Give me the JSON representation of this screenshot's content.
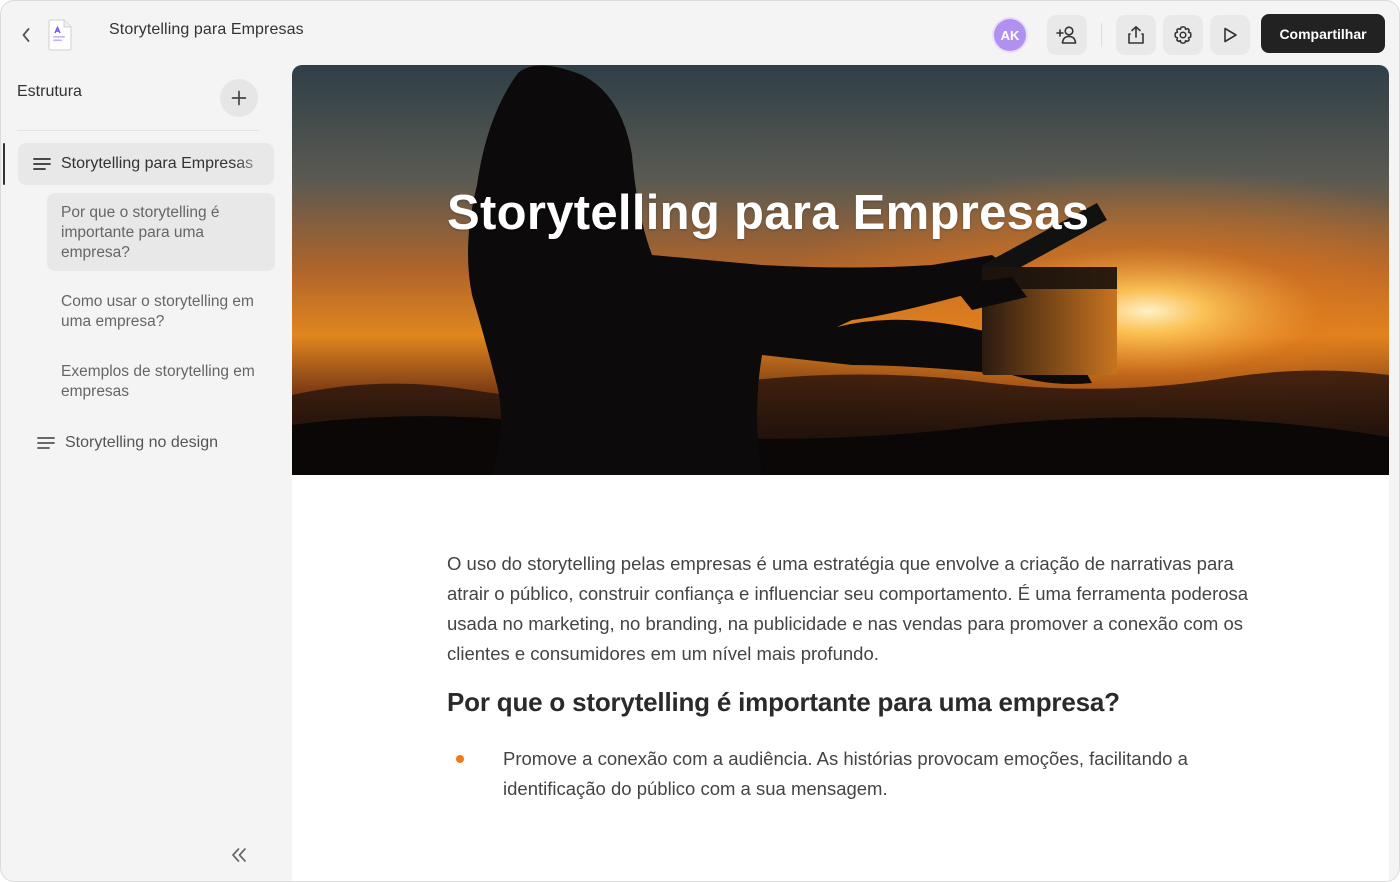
{
  "topbar": {
    "document_title": "Storytelling para Empresas",
    "avatar_initials": "AK",
    "share_label": "Compartilhar"
  },
  "sidebar": {
    "header": "Estrutura",
    "items": [
      {
        "label": "Storytelling para Empresas",
        "level": 1,
        "active": true
      },
      {
        "label": "Por que o storytelling é importante para uma empresa?",
        "level": 2,
        "highlighted": true
      },
      {
        "label": "Como usar o storytelling em uma empresa?",
        "level": 2
      },
      {
        "label": "Exemplos de storytelling em empresas",
        "level": 2
      },
      {
        "label": "Storytelling no design",
        "level": 1
      }
    ]
  },
  "main": {
    "hero_title": "Storytelling para Empresas",
    "paragraph": "O uso do storytelling pelas empresas é uma estratégia que envolve a criação de narrativas para atrair o público, construir confiança e influenciar seu comportamento. É uma ferramenta poderosa usada no marketing, no branding, na publicidade e nas vendas para promover a conexão com os clientes e consumidores em um nível mais profundo.",
    "heading": "Por que o storytelling é importante para uma empresa?",
    "bullets": [
      "Promove a conexão com a audiência. As histórias provocam emoções, facilitando a identificação do público com a sua mensagem."
    ]
  },
  "colors": {
    "accent_bullet": "#f07a1a",
    "avatar_bg": "#b191f0",
    "share_button_bg": "#222222"
  },
  "icons": [
    "back-icon",
    "document-icon",
    "add-user-icon",
    "share-icon",
    "settings-icon",
    "play-icon",
    "plus-icon",
    "lines-icon",
    "double-chevron-left-icon"
  ]
}
